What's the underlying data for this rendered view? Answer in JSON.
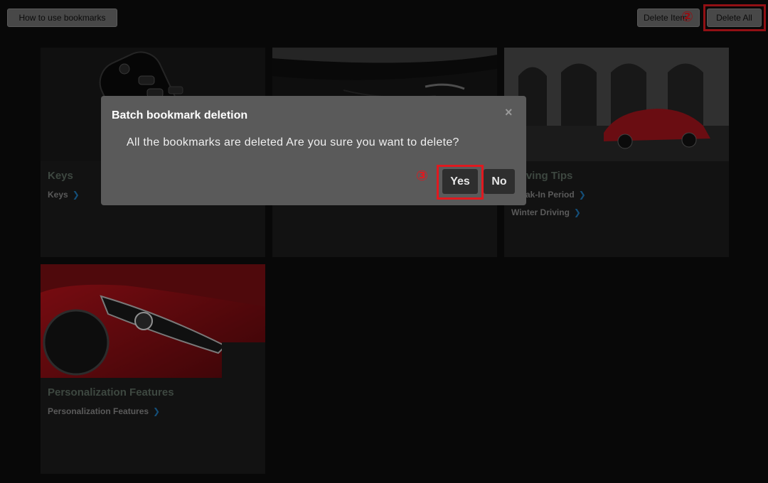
{
  "toolbar": {
    "how_to_label": "How to use bookmarks",
    "delete_item_label": "Delete Item",
    "delete_all_label": "Delete All"
  },
  "annotations": {
    "step2": "②",
    "step3": "③",
    "highlight_color": "#e0191f"
  },
  "cards": [
    {
      "title": "Keys",
      "links": [
        "Keys"
      ]
    },
    {
      "title": "",
      "links": []
    },
    {
      "title": "Driving Tips",
      "links": [
        "Break-In Period",
        "Winter Driving"
      ]
    },
    {
      "title": "Personalization Features",
      "links": [
        "Personalization Features"
      ]
    }
  ],
  "dialog": {
    "title": "Batch bookmark deletion",
    "close_icon": "×",
    "message": "All the bookmarks are deleted Are you sure you want to delete?",
    "yes_label": "Yes",
    "no_label": "No"
  },
  "icons": {
    "chevron": "❯"
  },
  "colors": {
    "link_chevron": "#1f78b8",
    "dialog_bg": "#5a5a5a",
    "page_bg": "#0d0d0d"
  }
}
